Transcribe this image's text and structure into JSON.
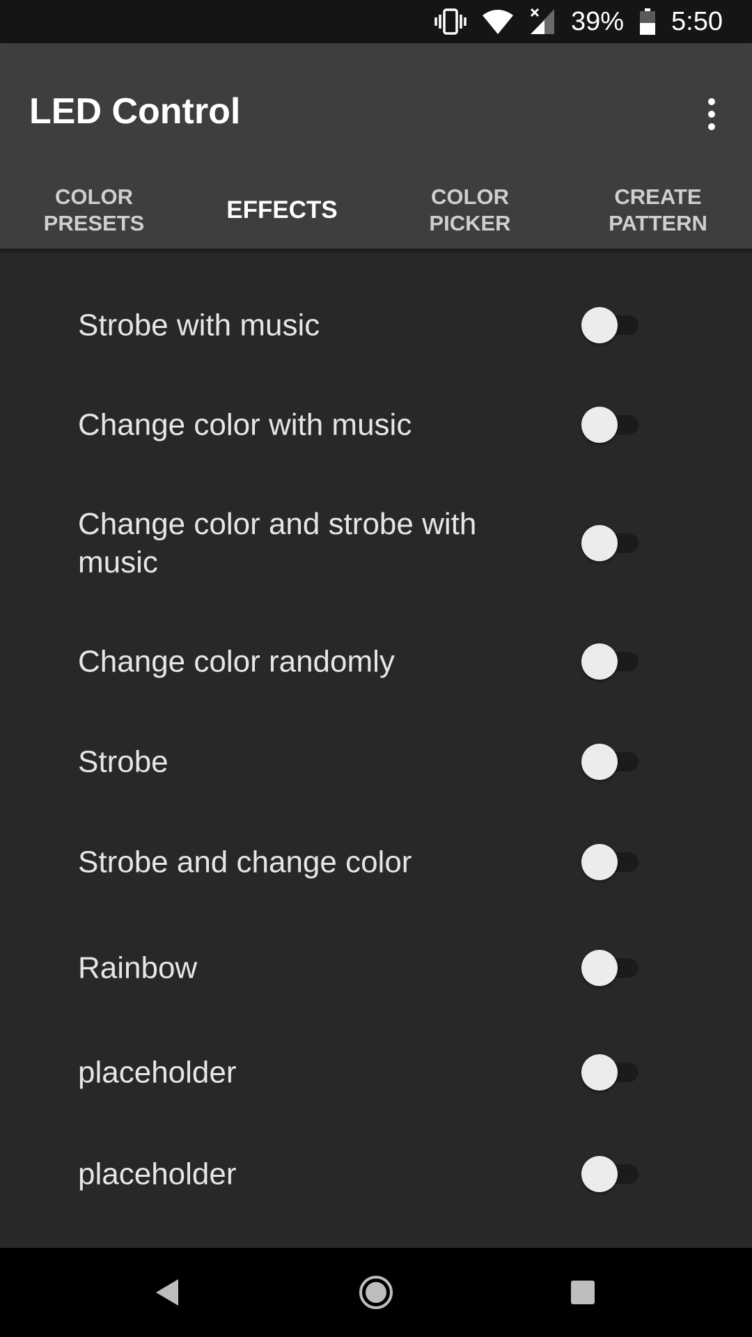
{
  "status_bar": {
    "battery_percent": "39%",
    "time": "5:50",
    "icons": [
      "vibrate-icon",
      "wifi-icon",
      "signal-icon",
      "battery-icon"
    ]
  },
  "app_bar": {
    "title": "LED Control",
    "menu_icon": "more-vert-icon"
  },
  "tabs": [
    {
      "label": "COLOR\nPRESETS",
      "active": false
    },
    {
      "label": "EFFECTS",
      "active": true
    },
    {
      "label": "COLOR\nPICKER",
      "active": false
    },
    {
      "label": "CREATE\nPATTERN",
      "active": false
    }
  ],
  "effects": [
    {
      "label": "Strobe with music",
      "enabled": false
    },
    {
      "label": "Change color with music",
      "enabled": false
    },
    {
      "label": "Change color and strobe with music",
      "enabled": false
    },
    {
      "label": "Change color randomly",
      "enabled": false
    },
    {
      "label": "Strobe",
      "enabled": false
    },
    {
      "label": "Strobe and change color",
      "enabled": false
    },
    {
      "label": "Rainbow",
      "enabled": false
    },
    {
      "label": "placeholder",
      "enabled": false
    },
    {
      "label": "placeholder",
      "enabled": false
    }
  ],
  "nav_bar": {
    "icons": [
      "back-icon",
      "home-icon",
      "recents-icon"
    ]
  },
  "colors": {
    "background": "#282828",
    "app_bar": "#3e3e3e",
    "status_bar": "#151515",
    "switch_thumb": "#ececec"
  }
}
